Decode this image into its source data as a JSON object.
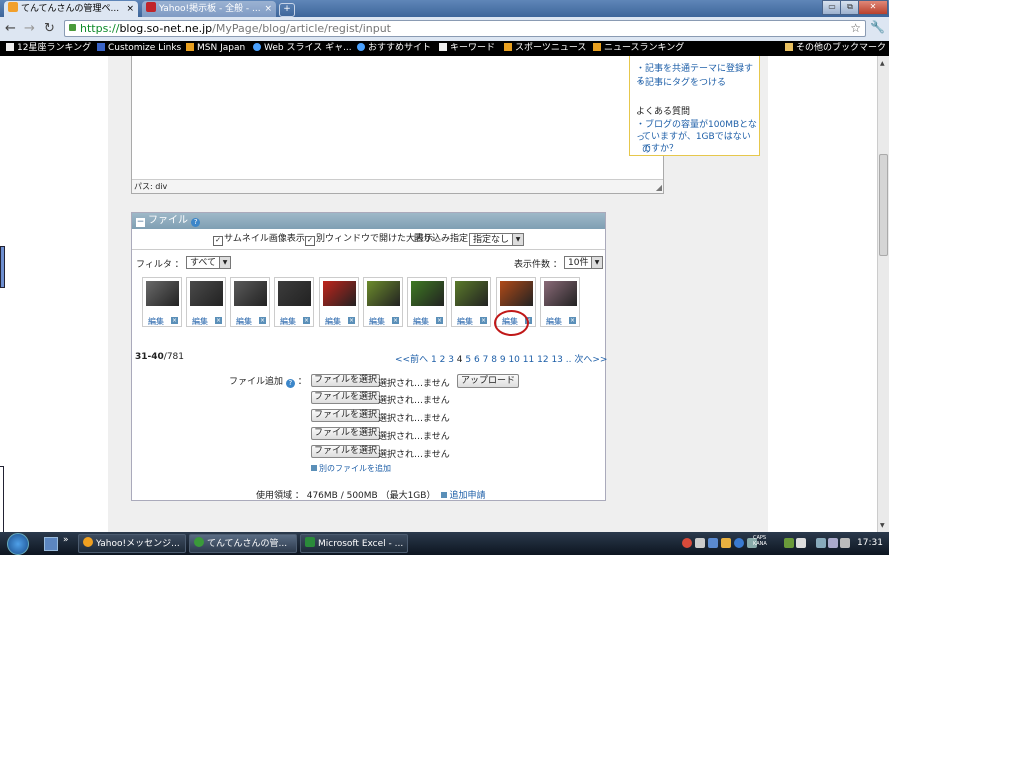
{
  "browser": {
    "tabs": [
      {
        "title": "てんてんさんの管理ペ...",
        "close": "×",
        "active": true,
        "favicon_color": "#f2a02b"
      },
      {
        "title": "Yahoo!掲示板 - 全般 - ...",
        "close": "×",
        "active": false,
        "favicon_color": "#c0242a"
      }
    ],
    "new_tab": "+",
    "window_controls": [
      "▭",
      "⧉",
      "✕"
    ],
    "address": {
      "scheme": "https://",
      "host": "blog.so-net.ne.jp",
      "path": "/MyPage/blog/article/regist/input"
    },
    "nav": {
      "back": "←",
      "forward": "→",
      "reload": "↻",
      "star": "☆",
      "wrench": "🔧"
    },
    "bookmarks": [
      {
        "label": "12星座ランキング",
        "icon": "page-icon"
      },
      {
        "label": "Customize Links",
        "icon": "m-icon"
      },
      {
        "label": "MSN Japan",
        "icon": "yahoo-icon"
      },
      {
        "label": "Web スライス ギャ...",
        "icon": "ie-icon"
      },
      {
        "label": "おすすめサイト",
        "icon": "ie-icon"
      },
      {
        "label": "キーワード",
        "icon": "page-icon"
      },
      {
        "label": "スポーツニュース",
        "icon": "yahoo-icon"
      },
      {
        "label": "ニュースランキング",
        "icon": "yahoo-icon"
      }
    ],
    "other_bookmarks": "その他のブックマーク"
  },
  "editor": {
    "path_label": "パス: div"
  },
  "help": {
    "links_top": [
      "記事を共通テーマに登録する",
      "記事にタグをつける"
    ],
    "faq_title": "よくある質問",
    "faq_lines": [
      "ブログの容量が100MBとなっ",
      "ていますが、1GBではないの",
      "ですか？"
    ]
  },
  "files": {
    "header": "ファイル",
    "help_icon": "?",
    "options": {
      "thumbnail": "サムネイル画像表示",
      "new_window": "別ウィンドウで開けた大表示",
      "wrap_label": "回り込み指定：",
      "wrap_value": "指定なし"
    },
    "filter_label": "フィルタ ：",
    "filter_value": "すべて",
    "count_label": "表示件数 ：",
    "count_value": "10件",
    "thumb_edit_label": "編集",
    "thumb_delete_label": "×",
    "thumbnails": [
      {
        "color": "#6a6a6a"
      },
      {
        "color": "#4a4a4a"
      },
      {
        "color": "#5a5a5a"
      },
      {
        "color": "#3c3c3c"
      },
      {
        "color": "#c0241c"
      },
      {
        "color": "#6c8c2c"
      },
      {
        "color": "#3e7a22"
      },
      {
        "color": "#5a7a2a"
      },
      {
        "color": "#b04a18"
      },
      {
        "color": "#8a6a78"
      }
    ],
    "range": {
      "from_to": "31-40",
      "total": "/781"
    },
    "pager": {
      "prev": "<<前へ",
      "pages": [
        "1",
        "2",
        "3",
        "4",
        "5",
        "6",
        "7",
        "8",
        "9",
        "10",
        "11",
        "12",
        "13"
      ],
      "current": "4",
      "ellipsis": "..",
      "next": "次へ>>"
    },
    "add_label": "ファイル追加",
    "add_colon": "：",
    "choose_button": "ファイルを選択",
    "file_status_first": "選択され…ません",
    "file_status": "選択され…ません",
    "upload_button": "アップロード",
    "add_more": "別のファイルを追加",
    "usage": "使用領域 ： 476MB / 500MB （最大1GB）",
    "usage_request": "追加申請"
  },
  "taskbar": {
    "tasks": [
      {
        "label": "Yahoo!メッセンジ...",
        "icon_color": "#f0a020"
      },
      {
        "label": "てんてんさんの管...",
        "icon_color": "#3a9a3a"
      },
      {
        "label": "Microsoft Excel - ...",
        "icon_color": "#2a8a3a"
      }
    ],
    "caps": [
      "CAPS",
      "KANA"
    ],
    "clock": "17:31"
  }
}
